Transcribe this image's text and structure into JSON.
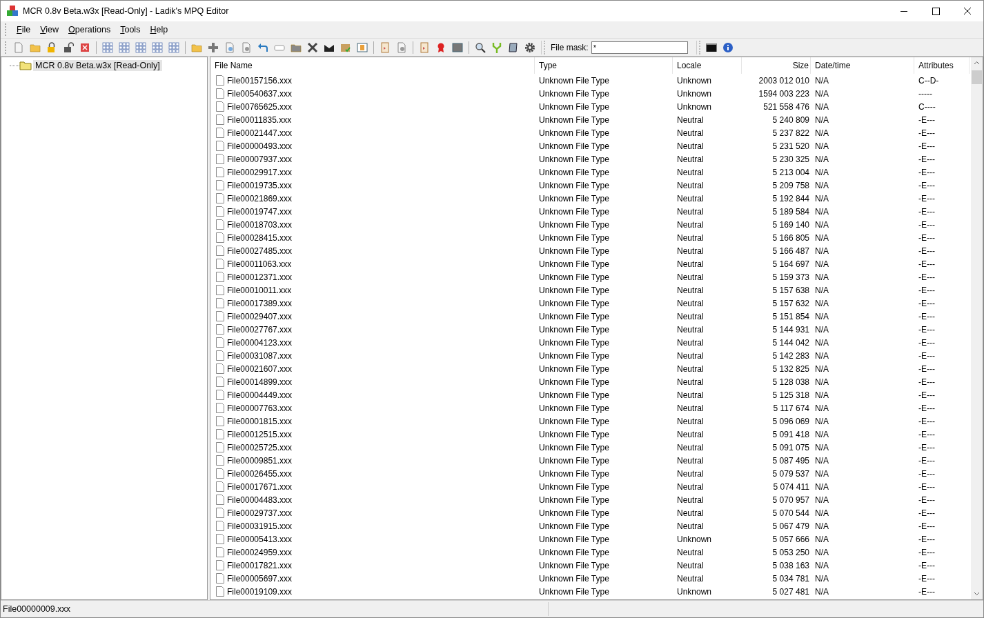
{
  "window": {
    "title": "MCR 0.8v Beta.w3x [Read-Only] - Ladik's MPQ Editor"
  },
  "menu": [
    "File",
    "View",
    "Operations",
    "Tools",
    "Help"
  ],
  "toolbar": {
    "file_mask_label": "File mask:",
    "file_mask_value": "*"
  },
  "tree": {
    "items": [
      {
        "label": "MCR 0.8v Beta.w3x [Read-Only]",
        "selected": true
      }
    ]
  },
  "table": {
    "columns": [
      "File Name",
      "Type",
      "Locale",
      "Size",
      "Date/time",
      "Attributes"
    ],
    "rows": [
      {
        "name": "File00157156.xxx",
        "type": "Unknown File Type",
        "locale": "Unknown",
        "size": "2003 012 010",
        "date": "N/A",
        "attributes": "C--D-"
      },
      {
        "name": "File00540637.xxx",
        "type": "Unknown File Type",
        "locale": "Unknown",
        "size": "1594 003 223",
        "date": "N/A",
        "attributes": "-----"
      },
      {
        "name": "File00765625.xxx",
        "type": "Unknown File Type",
        "locale": "Unknown",
        "size": "521 558 476",
        "date": "N/A",
        "attributes": "C----"
      },
      {
        "name": "File00011835.xxx",
        "type": "Unknown File Type",
        "locale": "Neutral",
        "size": "5 240 809",
        "date": "N/A",
        "attributes": "-E---"
      },
      {
        "name": "File00021447.xxx",
        "type": "Unknown File Type",
        "locale": "Neutral",
        "size": "5 237 822",
        "date": "N/A",
        "attributes": "-E---"
      },
      {
        "name": "File00000493.xxx",
        "type": "Unknown File Type",
        "locale": "Neutral",
        "size": "5 231 520",
        "date": "N/A",
        "attributes": "-E---"
      },
      {
        "name": "File00007937.xxx",
        "type": "Unknown File Type",
        "locale": "Neutral",
        "size": "5 230 325",
        "date": "N/A",
        "attributes": "-E---"
      },
      {
        "name": "File00029917.xxx",
        "type": "Unknown File Type",
        "locale": "Neutral",
        "size": "5 213 004",
        "date": "N/A",
        "attributes": "-E---"
      },
      {
        "name": "File00019735.xxx",
        "type": "Unknown File Type",
        "locale": "Neutral",
        "size": "5 209 758",
        "date": "N/A",
        "attributes": "-E---"
      },
      {
        "name": "File00021869.xxx",
        "type": "Unknown File Type",
        "locale": "Neutral",
        "size": "5 192 844",
        "date": "N/A",
        "attributes": "-E---"
      },
      {
        "name": "File00019747.xxx",
        "type": "Unknown File Type",
        "locale": "Neutral",
        "size": "5 189 584",
        "date": "N/A",
        "attributes": "-E---"
      },
      {
        "name": "File00018703.xxx",
        "type": "Unknown File Type",
        "locale": "Neutral",
        "size": "5 169 140",
        "date": "N/A",
        "attributes": "-E---"
      },
      {
        "name": "File00028415.xxx",
        "type": "Unknown File Type",
        "locale": "Neutral",
        "size": "5 166 805",
        "date": "N/A",
        "attributes": "-E---"
      },
      {
        "name": "File00027485.xxx",
        "type": "Unknown File Type",
        "locale": "Neutral",
        "size": "5 166 487",
        "date": "N/A",
        "attributes": "-E---"
      },
      {
        "name": "File00011063.xxx",
        "type": "Unknown File Type",
        "locale": "Neutral",
        "size": "5 164 697",
        "date": "N/A",
        "attributes": "-E---"
      },
      {
        "name": "File00012371.xxx",
        "type": "Unknown File Type",
        "locale": "Neutral",
        "size": "5 159 373",
        "date": "N/A",
        "attributes": "-E---"
      },
      {
        "name": "File00010011.xxx",
        "type": "Unknown File Type",
        "locale": "Neutral",
        "size": "5 157 638",
        "date": "N/A",
        "attributes": "-E---"
      },
      {
        "name": "File00017389.xxx",
        "type": "Unknown File Type",
        "locale": "Neutral",
        "size": "5 157 632",
        "date": "N/A",
        "attributes": "-E---"
      },
      {
        "name": "File00029407.xxx",
        "type": "Unknown File Type",
        "locale": "Neutral",
        "size": "5 151 854",
        "date": "N/A",
        "attributes": "-E---"
      },
      {
        "name": "File00027767.xxx",
        "type": "Unknown File Type",
        "locale": "Neutral",
        "size": "5 144 931",
        "date": "N/A",
        "attributes": "-E---"
      },
      {
        "name": "File00004123.xxx",
        "type": "Unknown File Type",
        "locale": "Neutral",
        "size": "5 144 042",
        "date": "N/A",
        "attributes": "-E---"
      },
      {
        "name": "File00031087.xxx",
        "type": "Unknown File Type",
        "locale": "Neutral",
        "size": "5 142 283",
        "date": "N/A",
        "attributes": "-E---"
      },
      {
        "name": "File00021607.xxx",
        "type": "Unknown File Type",
        "locale": "Neutral",
        "size": "5 132 825",
        "date": "N/A",
        "attributes": "-E---"
      },
      {
        "name": "File00014899.xxx",
        "type": "Unknown File Type",
        "locale": "Neutral",
        "size": "5 128 038",
        "date": "N/A",
        "attributes": "-E---"
      },
      {
        "name": "File00004449.xxx",
        "type": "Unknown File Type",
        "locale": "Neutral",
        "size": "5 125 318",
        "date": "N/A",
        "attributes": "-E---"
      },
      {
        "name": "File00007763.xxx",
        "type": "Unknown File Type",
        "locale": "Neutral",
        "size": "5 117 674",
        "date": "N/A",
        "attributes": "-E---"
      },
      {
        "name": "File00001815.xxx",
        "type": "Unknown File Type",
        "locale": "Neutral",
        "size": "5 096 069",
        "date": "N/A",
        "attributes": "-E---"
      },
      {
        "name": "File00012515.xxx",
        "type": "Unknown File Type",
        "locale": "Neutral",
        "size": "5 091 418",
        "date": "N/A",
        "attributes": "-E---"
      },
      {
        "name": "File00025725.xxx",
        "type": "Unknown File Type",
        "locale": "Neutral",
        "size": "5 091 075",
        "date": "N/A",
        "attributes": "-E---"
      },
      {
        "name": "File00009851.xxx",
        "type": "Unknown File Type",
        "locale": "Neutral",
        "size": "5 087 495",
        "date": "N/A",
        "attributes": "-E---"
      },
      {
        "name": "File00026455.xxx",
        "type": "Unknown File Type",
        "locale": "Neutral",
        "size": "5 079 537",
        "date": "N/A",
        "attributes": "-E---"
      },
      {
        "name": "File00017671.xxx",
        "type": "Unknown File Type",
        "locale": "Neutral",
        "size": "5 074 411",
        "date": "N/A",
        "attributes": "-E---"
      },
      {
        "name": "File00004483.xxx",
        "type": "Unknown File Type",
        "locale": "Neutral",
        "size": "5 070 957",
        "date": "N/A",
        "attributes": "-E---"
      },
      {
        "name": "File00029737.xxx",
        "type": "Unknown File Type",
        "locale": "Neutral",
        "size": "5 070 544",
        "date": "N/A",
        "attributes": "-E---"
      },
      {
        "name": "File00031915.xxx",
        "type": "Unknown File Type",
        "locale": "Neutral",
        "size": "5 067 479",
        "date": "N/A",
        "attributes": "-E---"
      },
      {
        "name": "File00005413.xxx",
        "type": "Unknown File Type",
        "locale": "Unknown",
        "size": "5 057 666",
        "date": "N/A",
        "attributes": "-E---"
      },
      {
        "name": "File00024959.xxx",
        "type": "Unknown File Type",
        "locale": "Neutral",
        "size": "5 053 250",
        "date": "N/A",
        "attributes": "-E---"
      },
      {
        "name": "File00017821.xxx",
        "type": "Unknown File Type",
        "locale": "Neutral",
        "size": "5 038 163",
        "date": "N/A",
        "attributes": "-E---"
      },
      {
        "name": "File00005697.xxx",
        "type": "Unknown File Type",
        "locale": "Neutral",
        "size": "5 034 781",
        "date": "N/A",
        "attributes": "-E---"
      },
      {
        "name": "File00019109.xxx",
        "type": "Unknown File Type",
        "locale": "Unknown",
        "size": "5 027 481",
        "date": "N/A",
        "attributes": "-E---"
      }
    ]
  },
  "status_bar": {
    "text": "File00000009.xxx"
  }
}
